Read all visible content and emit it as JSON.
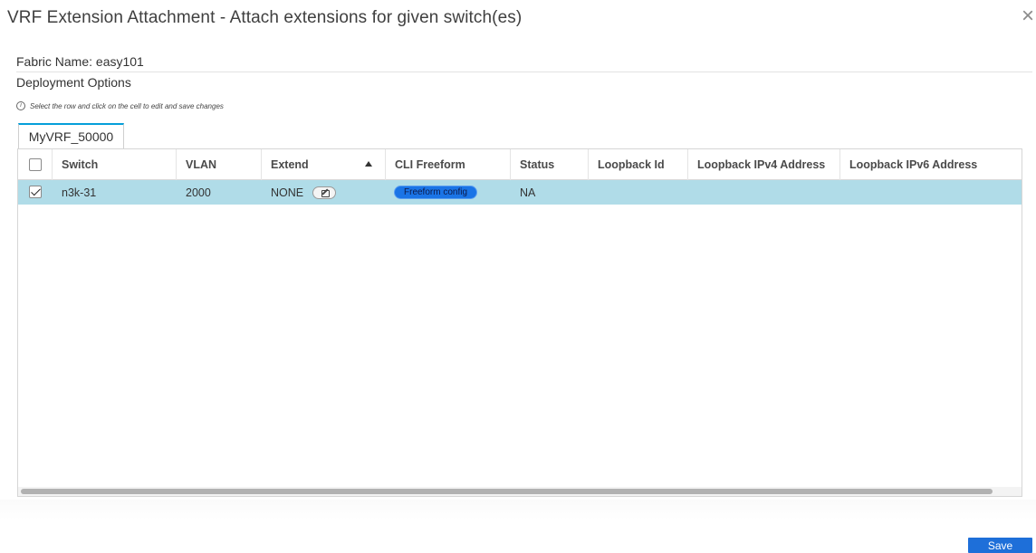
{
  "dialog": {
    "title": "VRF Extension Attachment - Attach extensions for given switch(es)",
    "close_glyph": "×"
  },
  "fabric": {
    "label": "Fabric Name: easy101"
  },
  "deployment": {
    "label": "Deployment Options",
    "hint": "Select the row and click on the cell to edit and save changes",
    "hint_icon": "info-icon"
  },
  "tabs": [
    {
      "label": "MyVRF_50000",
      "active": true
    }
  ],
  "table": {
    "columns": [
      {
        "key": "switch",
        "label": "Switch"
      },
      {
        "key": "vlan",
        "label": "VLAN"
      },
      {
        "key": "extend",
        "label": "Extend",
        "sorted": "ascending"
      },
      {
        "key": "cli_freeform",
        "label": "CLI Freeform"
      },
      {
        "key": "status",
        "label": "Status"
      },
      {
        "key": "loopback_id",
        "label": "Loopback Id"
      },
      {
        "key": "loopback_ipv4",
        "label": "Loopback IPv4 Address"
      },
      {
        "key": "loopback_ipv6",
        "label": "Loopback IPv6 Address"
      }
    ],
    "rows": [
      {
        "selected": true,
        "switch": "n3k-31",
        "vlan": "2000",
        "extend": "NONE",
        "cli_freeform": "Freeform config",
        "status": "NA",
        "loopback_id": "",
        "loopback_ipv4": "",
        "loopback_ipv6": ""
      }
    ],
    "row_highlight_color": "#b0dce8"
  },
  "footer": {
    "save_label": "Save"
  },
  "colors": {
    "accent": "#049fd9",
    "primary_button": "#1e6fd9",
    "freeform_button": "#1a74e6"
  }
}
